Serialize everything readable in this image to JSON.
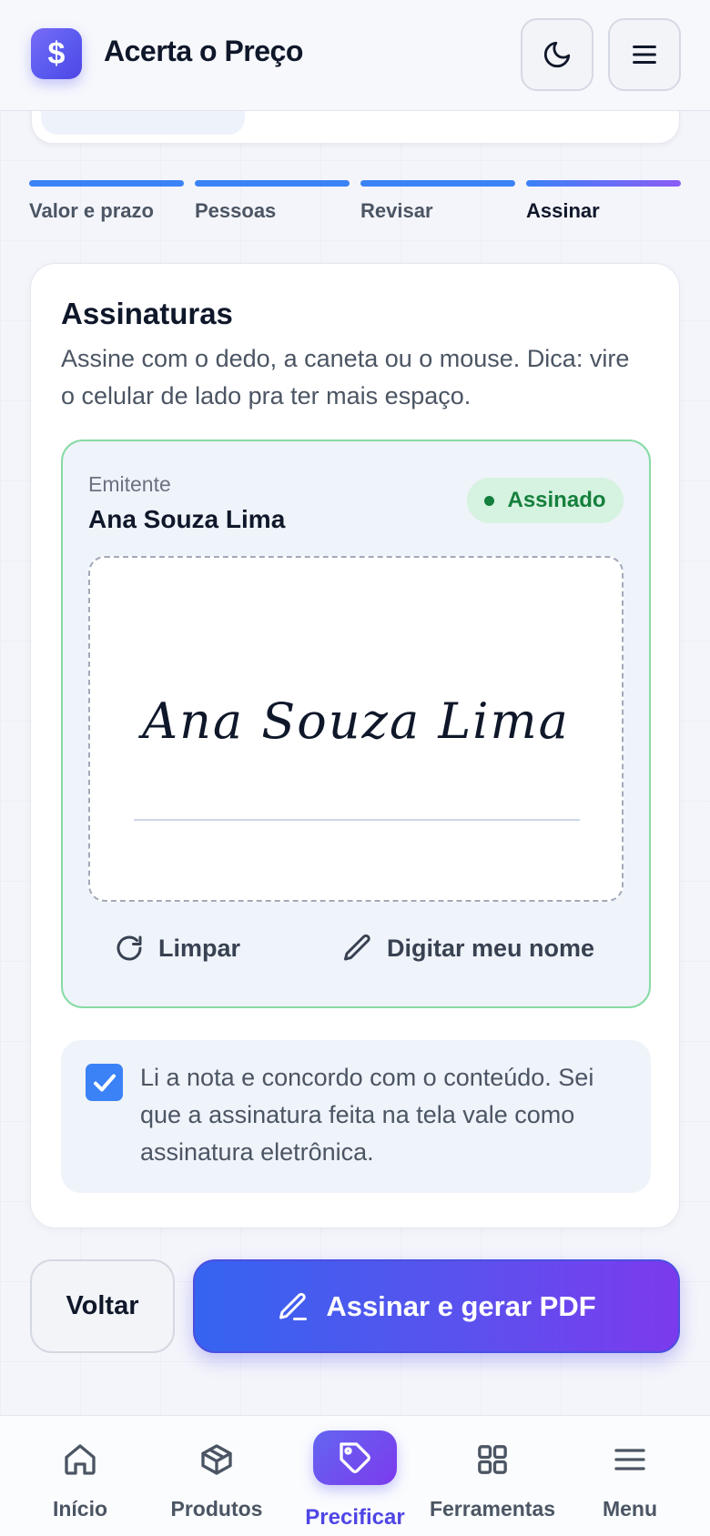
{
  "header": {
    "logo_symbol": "$",
    "title": "Acerta o Preço",
    "theme_icon": "moon-icon",
    "menu_icon": "hamburger-icon"
  },
  "stepper": {
    "steps": [
      {
        "label": "Valor e prazo",
        "state": "done"
      },
      {
        "label": "Pessoas",
        "state": "done"
      },
      {
        "label": "Revisar",
        "state": "done"
      },
      {
        "label": "Assinar",
        "state": "active"
      }
    ]
  },
  "signatures": {
    "title": "Assinaturas",
    "description": "Assine com o dedo, a caneta ou o mouse. Dica: vire o celular de lado pra ter mais espaço.",
    "signer": {
      "role": "Emitente",
      "name": "Ana Souza Lima",
      "status": "Assinado",
      "signature": "Ana Souza Lima"
    },
    "actions": {
      "clear_label": "Limpar",
      "clear_icon": "refresh-icon",
      "type_label": "Digitar meu nome",
      "type_icon": "pencil-icon"
    },
    "consent": {
      "checked": true,
      "text": "Li a nota e concordo com o conteúdo. Sei que a assinatura feita na tela vale como assinatura eletrônica."
    }
  },
  "footer_actions": {
    "back_label": "Voltar",
    "submit_label": "Assinar e gerar PDF",
    "submit_icon": "pencil-icon"
  },
  "bottom_nav": {
    "items": [
      {
        "label": "Início",
        "icon": "home-icon"
      },
      {
        "label": "Produtos",
        "icon": "box-icon"
      },
      {
        "label": "Precificar",
        "icon": "tag-icon",
        "active": true
      },
      {
        "label": "Ferramentas",
        "icon": "grid-icon"
      },
      {
        "label": "Menu",
        "icon": "menu-icon"
      }
    ]
  },
  "colors": {
    "accent": "#3b82f6",
    "brand_gradient_start": "#3564f0",
    "brand_gradient_end": "#7c3aed",
    "success": "#15803d",
    "success_bg": "#d6f2e0"
  }
}
